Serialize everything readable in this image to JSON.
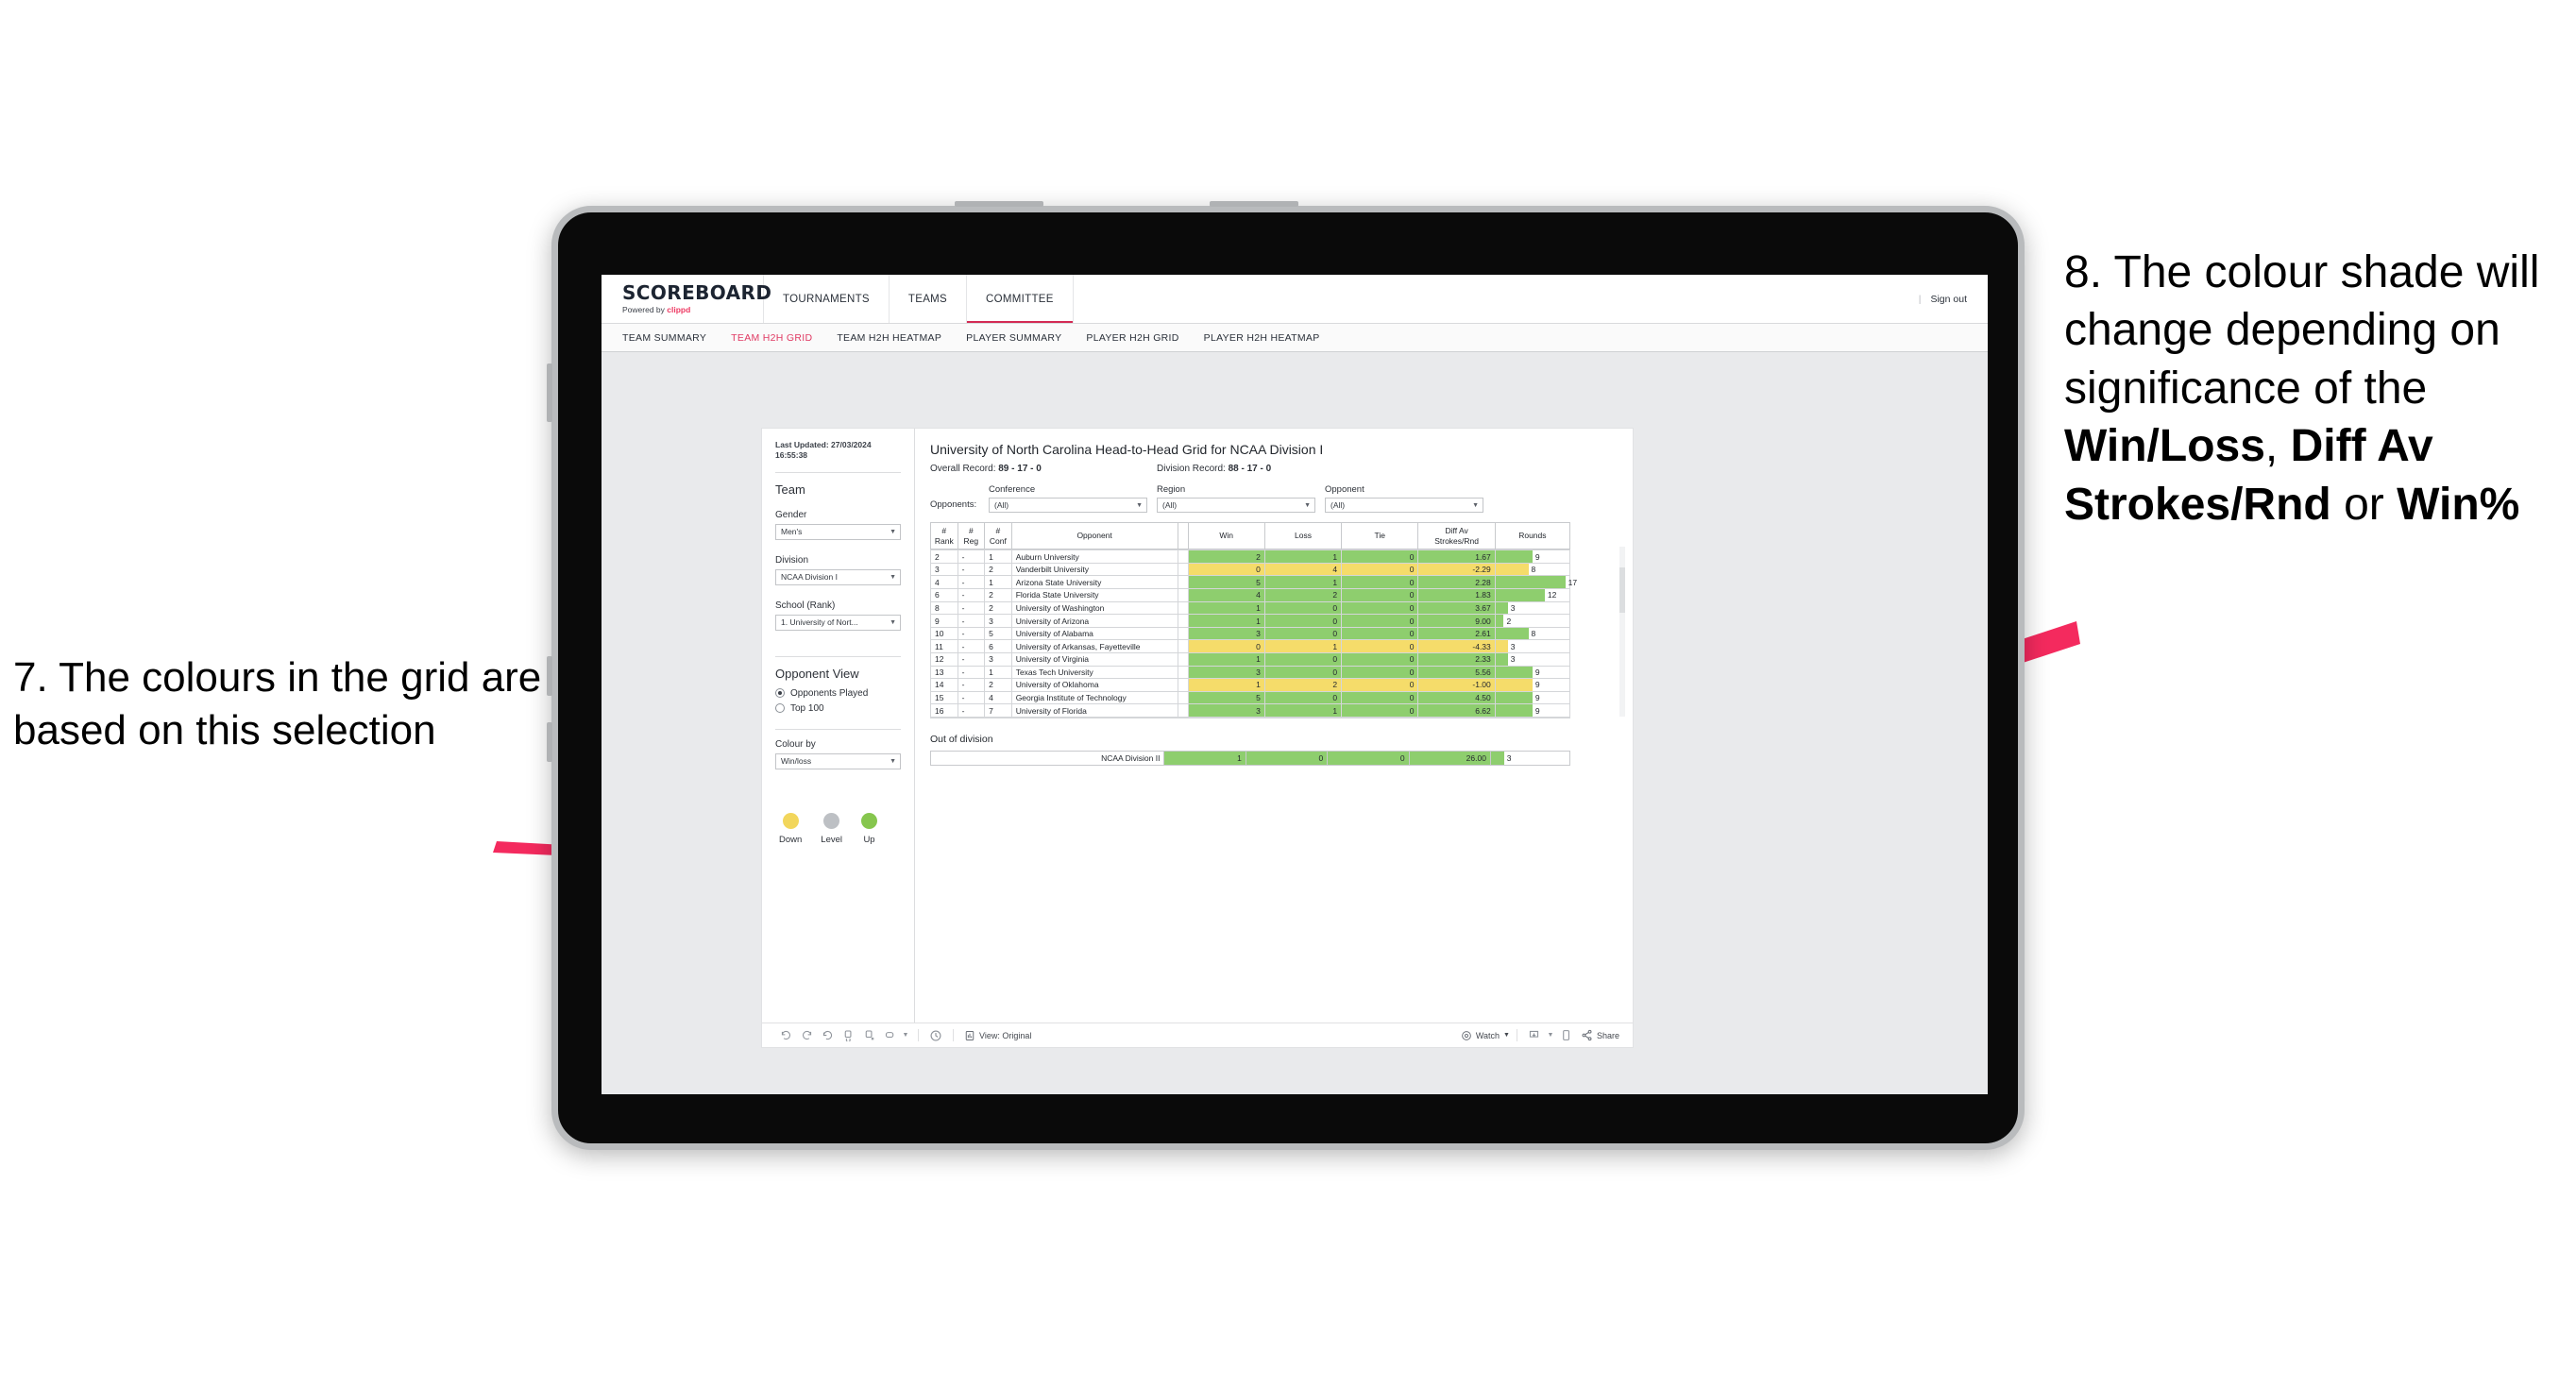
{
  "annotations": {
    "left": "7. The colours in the grid are based on this selection",
    "right_pre": "8. The colour shade will change depending on significance of the ",
    "right_b1": "Win/Loss",
    "right_mid1": ", ",
    "right_b2": "Diff Av Strokes/Rnd",
    "right_mid2": " or ",
    "right_b3": "Win%",
    "arrow_color": "#F42A5E"
  },
  "app": {
    "brand_title": "SCOREBOARD",
    "brand_sub_prefix": "Powered by ",
    "brand_sub_name": "clippd",
    "top_nav": [
      {
        "label": "TOURNAMENTS",
        "active": false
      },
      {
        "label": "TEAMS",
        "active": false
      },
      {
        "label": "COMMITTEE",
        "active": true
      }
    ],
    "sign_out": "Sign out",
    "divider": "|",
    "sub_nav": [
      {
        "label": "TEAM SUMMARY",
        "active": false
      },
      {
        "label": "TEAM H2H GRID",
        "active": true
      },
      {
        "label": "TEAM H2H HEATMAP",
        "active": false
      },
      {
        "label": "PLAYER SUMMARY",
        "active": false
      },
      {
        "label": "PLAYER H2H GRID",
        "active": false
      },
      {
        "label": "PLAYER H2H HEATMAP",
        "active": false
      }
    ],
    "accent_color": "#e03a63"
  },
  "sidebar": {
    "last_updated_label": "Last Updated:",
    "last_updated_value": "27/03/2024 16:55:38",
    "team_heading": "Team",
    "gender": {
      "label": "Gender",
      "value": "Men's"
    },
    "division": {
      "label": "Division",
      "value": "NCAA Division I"
    },
    "school": {
      "label": "School (Rank)",
      "value": "1. University of Nort..."
    },
    "opponent_view": {
      "heading": "Opponent View",
      "options": [
        {
          "label": "Opponents Played",
          "selected": true
        },
        {
          "label": "Top 100",
          "selected": false
        }
      ]
    },
    "colour_by": {
      "label": "Colour by",
      "value": "Win/loss"
    },
    "legend": [
      {
        "label": "Down",
        "color": "#F2D65C"
      },
      {
        "label": "Level",
        "color": "#BDC0C4"
      },
      {
        "label": "Up",
        "color": "#86C64E"
      }
    ]
  },
  "main": {
    "title": "University of North Carolina Head-to-Head Grid for NCAA Division I",
    "overall_record_label": "Overall Record:",
    "overall_record_value": "89 - 17 - 0",
    "division_record_label": "Division Record:",
    "division_record_value": "88 - 17 - 0",
    "opponents_label": "Opponents:",
    "filters": [
      {
        "label": "Conference",
        "value": "(All)"
      },
      {
        "label": "Region",
        "value": "(All)"
      },
      {
        "label": "Opponent",
        "value": "(All)"
      }
    ],
    "out_of_division_title": "Out of division"
  },
  "chart_data": {
    "type": "table",
    "title": "University of North Carolina Head-to-Head Grid for NCAA Division I",
    "columns": [
      "# Rank",
      "# Reg",
      "# Conf",
      "Opponent",
      "Win",
      "Loss",
      "Tie",
      "Diff Av Strokes/Rnd",
      "Rounds"
    ],
    "colour_by": "Win/loss",
    "colors": {
      "up": "#8ECE6E",
      "down": "#F5DC6A",
      "level": "#BDC0C4"
    },
    "rounds_axis_max": 18,
    "rows": [
      {
        "rank": "2",
        "reg": "-",
        "conf": "1",
        "opponent": "Auburn University",
        "win": 2,
        "loss": 1,
        "tie": 0,
        "diff": "1.67",
        "rounds": 9,
        "state": "up"
      },
      {
        "rank": "3",
        "reg": "-",
        "conf": "2",
        "opponent": "Vanderbilt University",
        "win": 0,
        "loss": 4,
        "tie": 0,
        "diff": "-2.29",
        "rounds": 8,
        "state": "down"
      },
      {
        "rank": "4",
        "reg": "-",
        "conf": "1",
        "opponent": "Arizona State University",
        "win": 5,
        "loss": 1,
        "tie": 0,
        "diff": "2.28",
        "rounds": 17,
        "state": "up"
      },
      {
        "rank": "6",
        "reg": "-",
        "conf": "2",
        "opponent": "Florida State University",
        "win": 4,
        "loss": 2,
        "tie": 0,
        "diff": "1.83",
        "rounds": 12,
        "state": "up"
      },
      {
        "rank": "8",
        "reg": "-",
        "conf": "2",
        "opponent": "University of Washington",
        "win": 1,
        "loss": 0,
        "tie": 0,
        "diff": "3.67",
        "rounds": 3,
        "state": "up"
      },
      {
        "rank": "9",
        "reg": "-",
        "conf": "3",
        "opponent": "University of Arizona",
        "win": 1,
        "loss": 0,
        "tie": 0,
        "diff": "9.00",
        "rounds": 2,
        "state": "up"
      },
      {
        "rank": "10",
        "reg": "-",
        "conf": "5",
        "opponent": "University of Alabama",
        "win": 3,
        "loss": 0,
        "tie": 0,
        "diff": "2.61",
        "rounds": 8,
        "state": "up"
      },
      {
        "rank": "11",
        "reg": "-",
        "conf": "6",
        "opponent": "University of Arkansas, Fayetteville",
        "win": 0,
        "loss": 1,
        "tie": 0,
        "diff": "-4.33",
        "rounds": 3,
        "state": "down"
      },
      {
        "rank": "12",
        "reg": "-",
        "conf": "3",
        "opponent": "University of Virginia",
        "win": 1,
        "loss": 0,
        "tie": 0,
        "diff": "2.33",
        "rounds": 3,
        "state": "up"
      },
      {
        "rank": "13",
        "reg": "-",
        "conf": "1",
        "opponent": "Texas Tech University",
        "win": 3,
        "loss": 0,
        "tie": 0,
        "diff": "5.56",
        "rounds": 9,
        "state": "up"
      },
      {
        "rank": "14",
        "reg": "-",
        "conf": "2",
        "opponent": "University of Oklahoma",
        "win": 1,
        "loss": 2,
        "tie": 0,
        "diff": "-1.00",
        "rounds": 9,
        "state": "down"
      },
      {
        "rank": "15",
        "reg": "-",
        "conf": "4",
        "opponent": "Georgia Institute of Technology",
        "win": 5,
        "loss": 0,
        "tie": 0,
        "diff": "4.50",
        "rounds": 9,
        "state": "up"
      },
      {
        "rank": "16",
        "reg": "-",
        "conf": "7",
        "opponent": "University of Florida",
        "win": 3,
        "loss": 1,
        "tie": 0,
        "diff": "6.62",
        "rounds": 9,
        "state": "up"
      }
    ],
    "out_of_division": [
      {
        "opponent": "NCAA Division II",
        "win": 1,
        "loss": 0,
        "tie": 0,
        "diff": "26.00",
        "rounds": 3,
        "state": "up"
      }
    ]
  },
  "toolbar": {
    "icons": [
      "undo-icon",
      "redo-icon",
      "revert-icon",
      "refresh-icon",
      "pause-icon",
      "reset-icon",
      "dropdown-caret-icon",
      "clock-icon"
    ],
    "view_label": "View: Original",
    "watch_label": "Watch",
    "share_label": "Share",
    "download_icon": "download-icon",
    "device_icon": "device-preview-icon",
    "share_icon": "share-icon",
    "view_icon": "view-icon",
    "watch_icon": "watch-icon"
  }
}
